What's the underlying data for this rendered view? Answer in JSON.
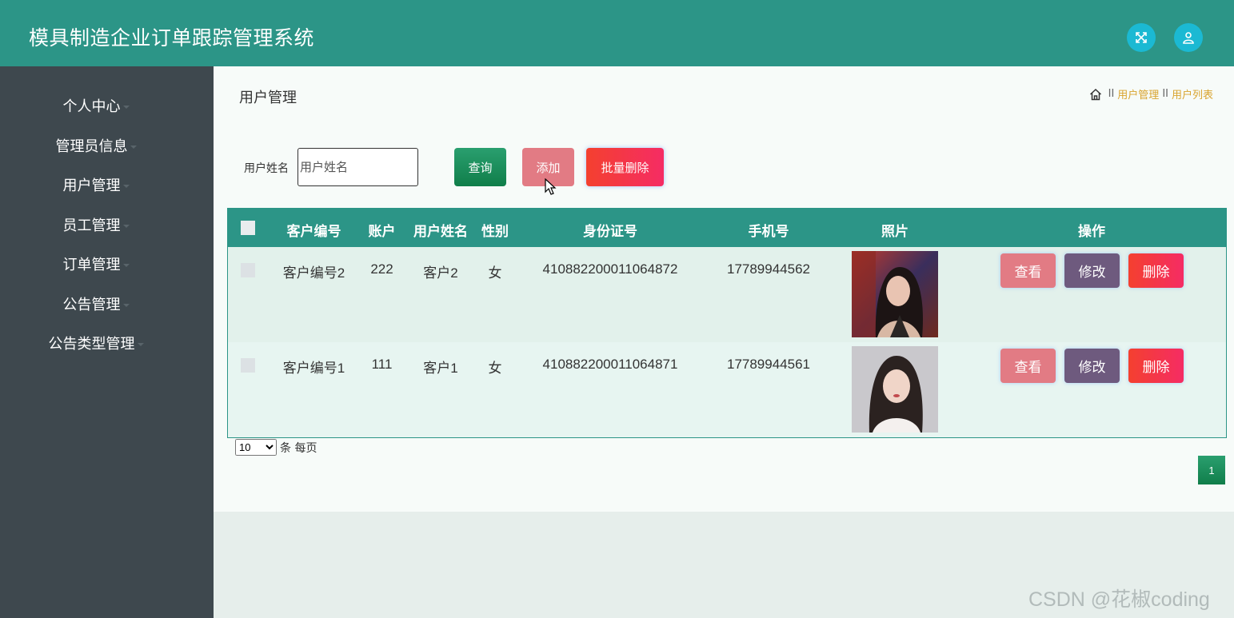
{
  "app": {
    "title": "模具制造企业订单跟踪管理系统"
  },
  "header": {
    "fullscreen_icon": "fullscreen-icon",
    "user_icon": "user-icon"
  },
  "sidebar": {
    "items": [
      {
        "label": "个人中心"
      },
      {
        "label": "管理员信息"
      },
      {
        "label": "用户管理"
      },
      {
        "label": "员工管理"
      },
      {
        "label": "订单管理"
      },
      {
        "label": "公告管理"
      },
      {
        "label": "公告类型管理"
      }
    ]
  },
  "page": {
    "title": "用户管理",
    "breadcrumb": [
      "用户管理",
      "用户列表"
    ],
    "breadcrumb_sep": "II"
  },
  "search": {
    "label": "用户姓名",
    "placeholder": "用户姓名",
    "value": "",
    "query_label": "查询",
    "add_label": "添加",
    "batch_delete_label": "批量删除"
  },
  "table": {
    "headers": [
      "客户编号",
      "账户",
      "用户姓名",
      "性别",
      "身份证号",
      "手机号",
      "照片",
      "操作"
    ],
    "rows": [
      {
        "customer_no": "客户编号2",
        "account": "222",
        "name": "客户2",
        "gender": "女",
        "id_card": "410882200011064872",
        "phone": "17789944562"
      },
      {
        "customer_no": "客户编号1",
        "account": "111",
        "name": "客户1",
        "gender": "女",
        "id_card": "410882200011064871",
        "phone": "17789944561"
      }
    ],
    "actions": {
      "view": "查看",
      "edit": "修改",
      "delete": "删除"
    }
  },
  "pagination": {
    "page_size": "10",
    "page_size_suffix": "条 每页",
    "current_page": "1"
  },
  "watermark": "CSDN @花椒coding",
  "colors": {
    "header": "#2c9587",
    "sidebar": "#3e484e",
    "accent_pink": "#e27b84",
    "accent_red": "#f4402f",
    "accent_purple": "#6e5a7e"
  }
}
